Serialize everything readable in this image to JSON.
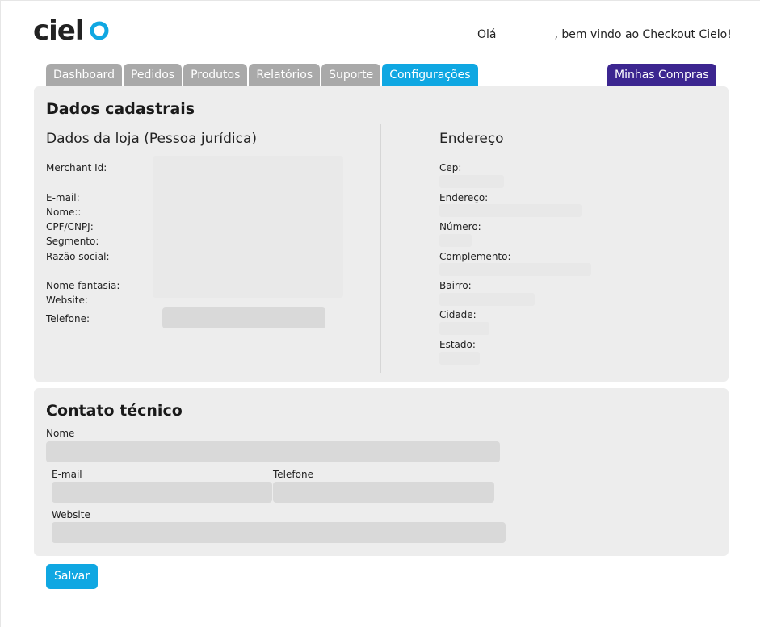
{
  "brand": {
    "logo_text": "cielo",
    "logo_color": "#222222",
    "logo_accent": "#0fa7e2"
  },
  "header": {
    "greeting_prefix": "Olá",
    "greeting_suffix": ", bem vindo ao Checkout Cielo!"
  },
  "nav": {
    "tabs": [
      {
        "label": "Dashboard",
        "active": false
      },
      {
        "label": "Pedidos",
        "active": false
      },
      {
        "label": "Produtos",
        "active": false
      },
      {
        "label": "Relatórios",
        "active": false
      },
      {
        "label": "Suporte",
        "active": false
      },
      {
        "label": "Configurações",
        "active": true
      }
    ],
    "purchases_label": "Minhas Compras"
  },
  "colors": {
    "tab_inactive": "#a9a9a9",
    "tab_active": "#0fa7e2",
    "purchases": "#3c2690",
    "panel_bg": "#ededed"
  },
  "dados_cadastrais": {
    "title": "Dados cadastrais",
    "loja": {
      "subtitle": "Dados da loja (Pessoa jurídica)",
      "merchant_id_label": "Merchant Id:",
      "email_label": "E-mail:",
      "nome_label": "Nome::",
      "cpf_cnpj_label": "CPF/CNPJ:",
      "segmento_label": "Segmento:",
      "razao_social_label": "Razão social:",
      "nome_fantasia_label": "Nome fantasia:",
      "website_label": "Website:",
      "telefone_label": "Telefone:",
      "telefone_value": ""
    },
    "endereco": {
      "subtitle": "Endereço",
      "cep_label": "Cep:",
      "endereco_label": "Endereço:",
      "numero_label": "Número:",
      "complemento_label": "Complemento:",
      "bairro_label": "Bairro:",
      "cidade_label": "Cidade:",
      "estado_label": "Estado:"
    }
  },
  "contato_tecnico": {
    "title": "Contato técnico",
    "nome_label": "Nome",
    "nome_value": "",
    "email_label": "E-mail",
    "email_value": "",
    "telefone_label": "Telefone",
    "telefone_value": "",
    "website_label": "Website",
    "website_value": ""
  },
  "actions": {
    "save_label": "Salvar"
  }
}
